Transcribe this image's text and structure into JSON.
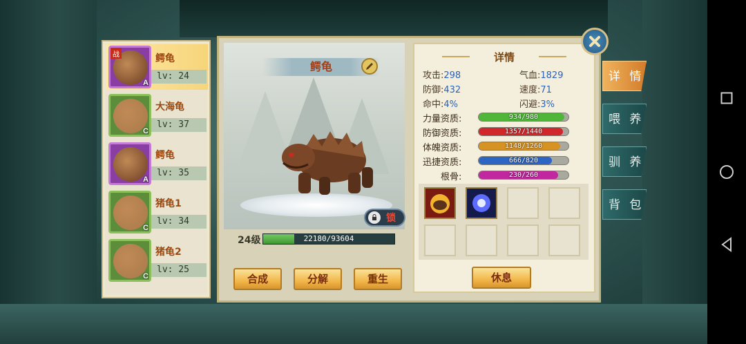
{
  "pet_list": [
    {
      "name": "鳄龟",
      "level": "lv: 24",
      "grade": "A",
      "frame": "purple",
      "battle_tag": "战",
      "selected": true
    },
    {
      "name": "大海龟",
      "level": "lv: 37",
      "grade": "C",
      "frame": "green",
      "battle_tag": "",
      "selected": false
    },
    {
      "name": "鳄龟",
      "level": "lv: 35",
      "grade": "A",
      "frame": "purple",
      "battle_tag": "",
      "selected": false
    },
    {
      "name": "猪龟1",
      "level": "lv: 34",
      "grade": "C",
      "frame": "green",
      "battle_tag": "",
      "selected": false
    },
    {
      "name": "猪龟2",
      "level": "lv: 25",
      "grade": "C",
      "frame": "green",
      "battle_tag": "",
      "selected": false
    }
  ],
  "preview": {
    "pet_name": "鳄龟",
    "lock_label": "锁",
    "level_label": "24级",
    "exp_text": "22180/93604",
    "exp_fraction": 0.237
  },
  "actions": {
    "merge": "合成",
    "decompose": "分解",
    "rebirth": "重生",
    "rest": "休息"
  },
  "details": {
    "title": "详情",
    "stats": [
      {
        "label": "攻击:",
        "value": "298"
      },
      {
        "label": "气血:",
        "value": "1829"
      },
      {
        "label": "防御:",
        "value": "432"
      },
      {
        "label": "速度:",
        "value": "71"
      },
      {
        "label": "命中:",
        "value": "4%"
      },
      {
        "label": "闪避:",
        "value": "3%"
      }
    ],
    "aptitudes": [
      {
        "label": "力量资质:",
        "text": "934/980",
        "fraction": 0.953,
        "color": "#4fb63a"
      },
      {
        "label": "防御资质:",
        "text": "1357/1440",
        "fraction": 0.942,
        "color": "#d2272a"
      },
      {
        "label": "体魄资质:",
        "text": "1148/1260",
        "fraction": 0.911,
        "color": "#d69223"
      },
      {
        "label": "迅捷资质:",
        "text": "666/820",
        "fraction": 0.812,
        "color": "#2c65c4"
      },
      {
        "label": "根骨:",
        "text": "230/260",
        "fraction": 0.885,
        "color": "#c1279f"
      }
    ],
    "skills": [
      "turtle-skill-icon",
      "blue-orb-skill-icon",
      "",
      "",
      "",
      "",
      "",
      ""
    ]
  },
  "tabs": [
    "详 情",
    "喂 养",
    "驯 养",
    "背 包"
  ],
  "active_tab": 0
}
